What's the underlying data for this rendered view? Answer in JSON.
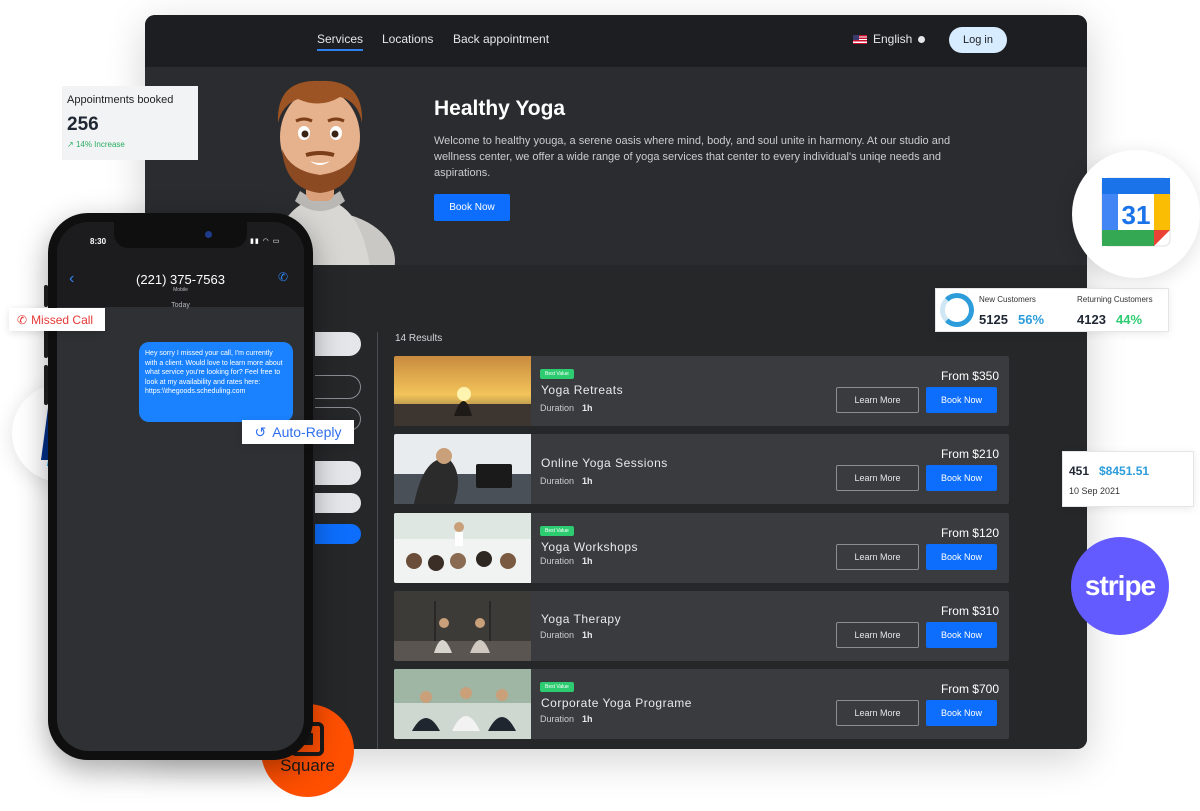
{
  "nav": {
    "links": [
      "Services",
      "Locations",
      "Back appointment"
    ],
    "language": "English",
    "login_label": "Log in"
  },
  "hero": {
    "title": "Healthy Yoga",
    "description": "Welcome to healthy youga, a serene oasis where mind, body, and soul unite in harmony. At our studio and wellness center, we offer a wide range of yoga services that center to every individual's uniqe needs and aspirations.",
    "book_label": "Book Now"
  },
  "results": {
    "count_label": "14 Results"
  },
  "services": [
    {
      "name": "Yoga Retreats",
      "badge": "Best Value",
      "duration_label": "Duration",
      "duration": "1h",
      "price": "From $350",
      "learn_label": "Learn More",
      "book_label": "Book Now"
    },
    {
      "name": "Online Yoga Sessions",
      "badge": "",
      "duration_label": "Duration",
      "duration": "1h",
      "price": "From $210",
      "learn_label": "Learn More",
      "book_label": "Book Now"
    },
    {
      "name": "Yoga Workshops",
      "badge": "Best Value",
      "duration_label": "Duration",
      "duration": "1h",
      "price": "From $120",
      "learn_label": "Learn More",
      "book_label": "Book Now"
    },
    {
      "name": "Yoga Therapy",
      "badge": "",
      "duration_label": "Duration",
      "duration": "1h",
      "price": "From $310",
      "learn_label": "Learn More",
      "book_label": "Book Now"
    },
    {
      "name": "Corporate Yoga Programe",
      "badge": "Best Value",
      "duration_label": "Duration",
      "duration": "1h",
      "price": "From $700",
      "learn_label": "Learn More",
      "book_label": "Book Now"
    }
  ],
  "appointments": {
    "title": "Appointments booked",
    "value": "256",
    "increase": "14% Increase"
  },
  "customers": {
    "new_label": "New Customers",
    "new_value": "5125",
    "new_pct": "56%",
    "returning_label": "Returning Customers",
    "returning_value": "4123",
    "returning_pct": "44%"
  },
  "payment": {
    "count": "451",
    "amount": "$8451.51",
    "date": "10 Sep 2021"
  },
  "phone": {
    "time": "8:30",
    "number": "(221) 375-7563",
    "number_sub": "Mobile",
    "day": "Today",
    "message": "Hey sorry I missed your call, I'm currently with a client. Would love to learn more about what service you're looking for? Feel free to look at my availability and rates here: https:\\\\thegoods.scheduling.com"
  },
  "tags": {
    "missed_call": "Missed Call",
    "auto_reply": "Auto-Reply"
  },
  "brands": {
    "calendar_day": "31",
    "stripe": "stripe",
    "square": "Square"
  },
  "colors": {
    "accent_blue": "#0d6efd",
    "badge_green": "#2ecc71",
    "stripe_purple": "#635bff",
    "square_orange": "#ff4f00",
    "paypal_dark": "#003087",
    "paypal_light": "#009cde"
  },
  "icons": {
    "back": "chevron-left-icon",
    "call": "phone-icon",
    "missed": "missed-call-icon",
    "auto_reply": "reply-icon",
    "growth": "arrow-up-right-icon"
  }
}
